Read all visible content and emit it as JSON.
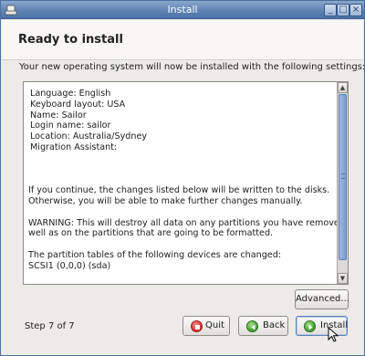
{
  "window": {
    "title": "Install",
    "controls": {
      "minimize": "_",
      "maximize": "□",
      "close": "×"
    }
  },
  "header": {
    "title": "Ready to install"
  },
  "intro_text": "Your new operating system will now be installed with the following settings:",
  "summary": {
    "lines": [
      "Language: English",
      "Keyboard layout: USA",
      "Name: Sailor",
      "Login name: sailor",
      "Location: Australia/Sydney",
      "Migration Assistant:",
      "",
      "",
      "",
      "If you continue, the changes listed below will be written to the disks.",
      "Otherwise, you will be able to make further changes manually.",
      "",
      "WARNING: This will destroy all data on any partitions you have removed as",
      "well as on the partitions that are going to be formatted.",
      "",
      "The partition tables of the following devices are changed:",
      " SCSI1 (0,0,0) (sda)"
    ]
  },
  "buttons": {
    "advanced": "Advanced...",
    "quit": "Quit",
    "back": "Back",
    "install": "Install"
  },
  "step": "Step 7 of 7",
  "colors": {
    "titlebar": "#5f83b3",
    "scroll_thumb": "#7c9dd0",
    "quit_icon": "#d32f2f",
    "go_icon": "#3f9b2f"
  }
}
